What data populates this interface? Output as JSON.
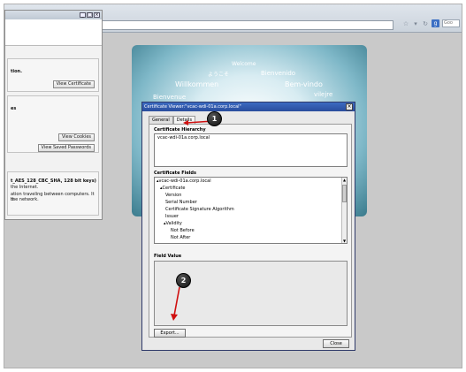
{
  "browser": {
    "toolbar_icons": [
      "star-icon",
      "refresh-icon"
    ],
    "search_placeholder": "Goo"
  },
  "page_info": {
    "security_text": "tion.",
    "view_certificate": "View Certificate",
    "privacy_label": "es",
    "view_cookies": "View Cookies",
    "view_saved_passwords": "View Saved Passwords",
    "cipher_text": "t_AES_128_CBC_SHA, 128 bit keys)",
    "line2": "the Internet.",
    "line3": "ation traveling between computers. It is",
    "line4": "the network."
  },
  "welcome_words": [
    "Welcome",
    "ようこそ",
    "Bienvenido",
    "Willkommen",
    "Bem-vindo",
    "Bienvenue",
    "vilejre"
  ],
  "dialog": {
    "title": "Certificate Viewer:\"vcac-wdi-01a.corp.local\"",
    "tabs": [
      {
        "label": "General"
      },
      {
        "label": "Details"
      }
    ],
    "hierarchy_label": "Certificate Hierarchy",
    "hierarchy_item": "vcac-wdi-01a.corp.local",
    "fields_label": "Certificate Fields",
    "fields": [
      "▴vcac-wdi-01a.corp.local",
      "▴Certificate",
      "Version",
      "Serial Number",
      "Certificate Signature Algorithm",
      "Issuer",
      "▴Validity",
      "Not Before",
      "Not After"
    ],
    "value_label": "Field Value",
    "export": "Export...",
    "close": "Close"
  },
  "callouts": [
    "1",
    "2"
  ]
}
